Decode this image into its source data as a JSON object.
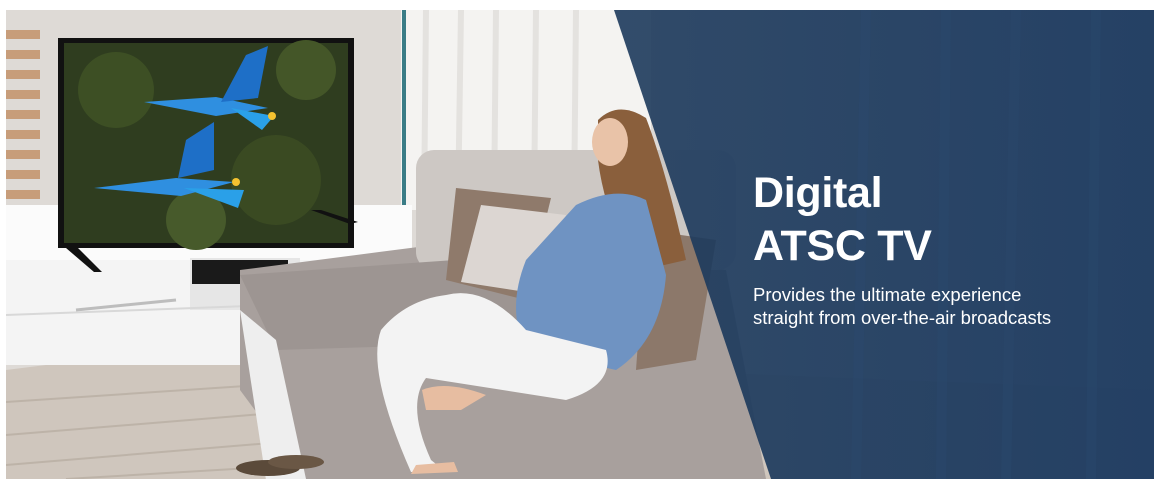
{
  "banner": {
    "headline_line1": "Digital",
    "headline_line2": "ATSC TV",
    "subtitle_line1": "Provides the ultimate experience",
    "subtitle_line2": "straight from over-the-air broadcasts",
    "image_alt": "Woman sitting on a sofa watching a flat-screen TV showing two blue macaws in flight",
    "colors": {
      "overlay": "#1f3a5c",
      "text": "#ffffff",
      "wall": "#d9d4cf",
      "floor": "#cfc7bf",
      "sofa": "#a79f9c",
      "shirt": "#6f93c2",
      "pants": "#f2f2f2",
      "macaw": "#2f8fe0"
    }
  }
}
